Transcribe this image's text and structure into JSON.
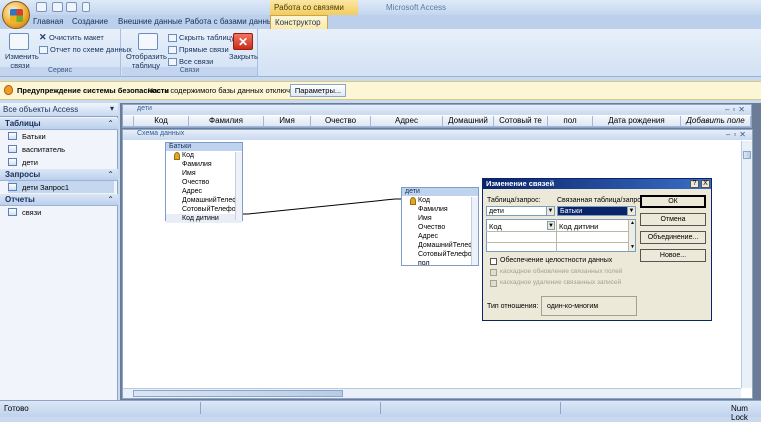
{
  "window": {
    "context_tab_title": "Работа со связями",
    "app_title": "Microsoft Access"
  },
  "tabs": [
    {
      "label": "Главная"
    },
    {
      "label": "Создание"
    },
    {
      "label": "Внешние данные"
    },
    {
      "label": "Работа с базами данных"
    },
    {
      "label": "Конструктор",
      "active": true
    }
  ],
  "ribbon": {
    "service": {
      "label": "Сервис",
      "edit_links": [
        "Изменить",
        "связи"
      ],
      "clear_layout": "Очистить макет",
      "report": "Отчет по схеме данных"
    },
    "links": {
      "label": "Связи",
      "show_table": [
        "Отобразить",
        "таблицу"
      ],
      "hide_table": "Скрыть таблицу",
      "direct_links": "Прямые связи",
      "all_links": "Все связи",
      "close": "Закрыть"
    }
  },
  "security": {
    "title": "Предупреждение системы безопасности",
    "message": "Часть содержимого базы данных отключено",
    "button": "Параметры..."
  },
  "nav": {
    "header": "Все объекты Access",
    "sections": [
      {
        "title": "Таблицы",
        "items": [
          "Батьки",
          "васпитатель",
          "дети"
        ]
      },
      {
        "title": "Запросы",
        "items": [
          "дети Запрос1"
        ]
      },
      {
        "title": "Отчеты",
        "items": [
          "связи"
        ]
      }
    ]
  },
  "datasheet": {
    "title": "дети",
    "columns": [
      "Код",
      "Фамилия",
      "Имя",
      "Очество",
      "Адрес",
      "Домашний",
      "Сотовый те",
      "пол",
      "Дата рождения",
      "Добавить поле"
    ]
  },
  "schema": {
    "title": "Схема данных",
    "tables": [
      {
        "title": "Батьки",
        "fields": [
          "Код",
          "Фамилия",
          "Имя",
          "Очество",
          "Адрес",
          "ДомашнийТелефо",
          "СотовыйТелефон",
          "Код дитини"
        ]
      },
      {
        "title": "дети",
        "fields": [
          "Код",
          "Фамилия",
          "Имя",
          "Очество",
          "Адрес",
          "ДомашнийТелеф",
          "СотовыйТелефон",
          "пол"
        ]
      }
    ]
  },
  "dialog": {
    "title": "Изменение связей",
    "help": "?",
    "close": "X",
    "table_label": "Таблица/запрос:",
    "related_label": "Связанная таблица/запрос:",
    "table_value": "дети",
    "related_value": "Батьки",
    "field_left": "Код",
    "field_right": "Код дитини",
    "integrity": "Обеспечение целостности данных",
    "cascade_update": "каскадное обновление связанных полей",
    "cascade_delete": "каскадное удаление связанных записей",
    "relation_label": "Тип отношения:",
    "relation_value": "один-ко-многим",
    "ok": "ОК",
    "cancel": "Отмена",
    "join": "Объединение...",
    "new": "Новое..."
  },
  "status": {
    "ready": "Готово",
    "numlock": "Num Lock"
  }
}
